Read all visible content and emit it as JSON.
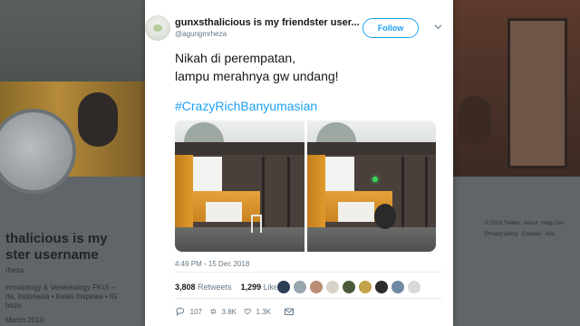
{
  "background_profile": {
    "name_line1": "thalicious is my",
    "name_line2": "ster username",
    "handle": "rheza",
    "bio_line1": "ermatology & Venereology FKUI –",
    "bio_line2": "rta, Indonesia • Kelas Inspirasi • IG",
    "bio_line3": "heza",
    "joined": "March 2010",
    "footer": [
      "© 2018 Twitter",
      "About",
      "Help Cen",
      "Privacy policy",
      "Cookies",
      "Ads"
    ]
  },
  "tweet": {
    "author_name": "gunxsthalicious is my friendster user...",
    "author_handle": "@agungmrheza",
    "follow_label": "Follow",
    "text_line1": "Nikah di perempatan,",
    "text_line2": "lampu merahnya gw undang!",
    "hashtag": "#CrazyRichBanyumasian",
    "timestamp": "4:49 PM - 15 Dec 2018",
    "retweets_count": "3,808",
    "retweets_label": "Retweets",
    "likes_count": "1,299",
    "likes_label": "Likes",
    "reply_count": "107",
    "retweet_action_count": "3.8K",
    "like_action_count": "1.3K"
  },
  "colors": {
    "accent": "#1da1f2",
    "text": "#14171a",
    "secondary": "#657786"
  },
  "icons": {
    "reply": "reply-icon",
    "retweet": "retweet-icon",
    "like": "heart-icon",
    "dm": "envelope-icon",
    "more": "chevron-down-icon"
  }
}
